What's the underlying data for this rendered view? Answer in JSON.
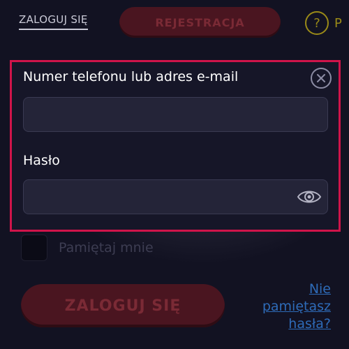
{
  "header": {
    "login_tab": "ZALOGUJ SIĘ",
    "register_button": "REJESTRACJA",
    "help_label": "P"
  },
  "form": {
    "phone_label": "Numer telefonu lub adres e-mail",
    "phone_value": "",
    "password_label": "Hasło",
    "password_value": ""
  },
  "remember": {
    "label": "Pamiętaj mnie"
  },
  "actions": {
    "login_button": "ZALOGUJ SIĘ",
    "forgot_link": "Nie pamiętasz hasła?"
  },
  "colors": {
    "accent_border": "#d0144a",
    "background": "#121222",
    "link": "#2e6bb8"
  },
  "icons": [
    "help-icon",
    "close-icon",
    "eye-icon"
  ]
}
